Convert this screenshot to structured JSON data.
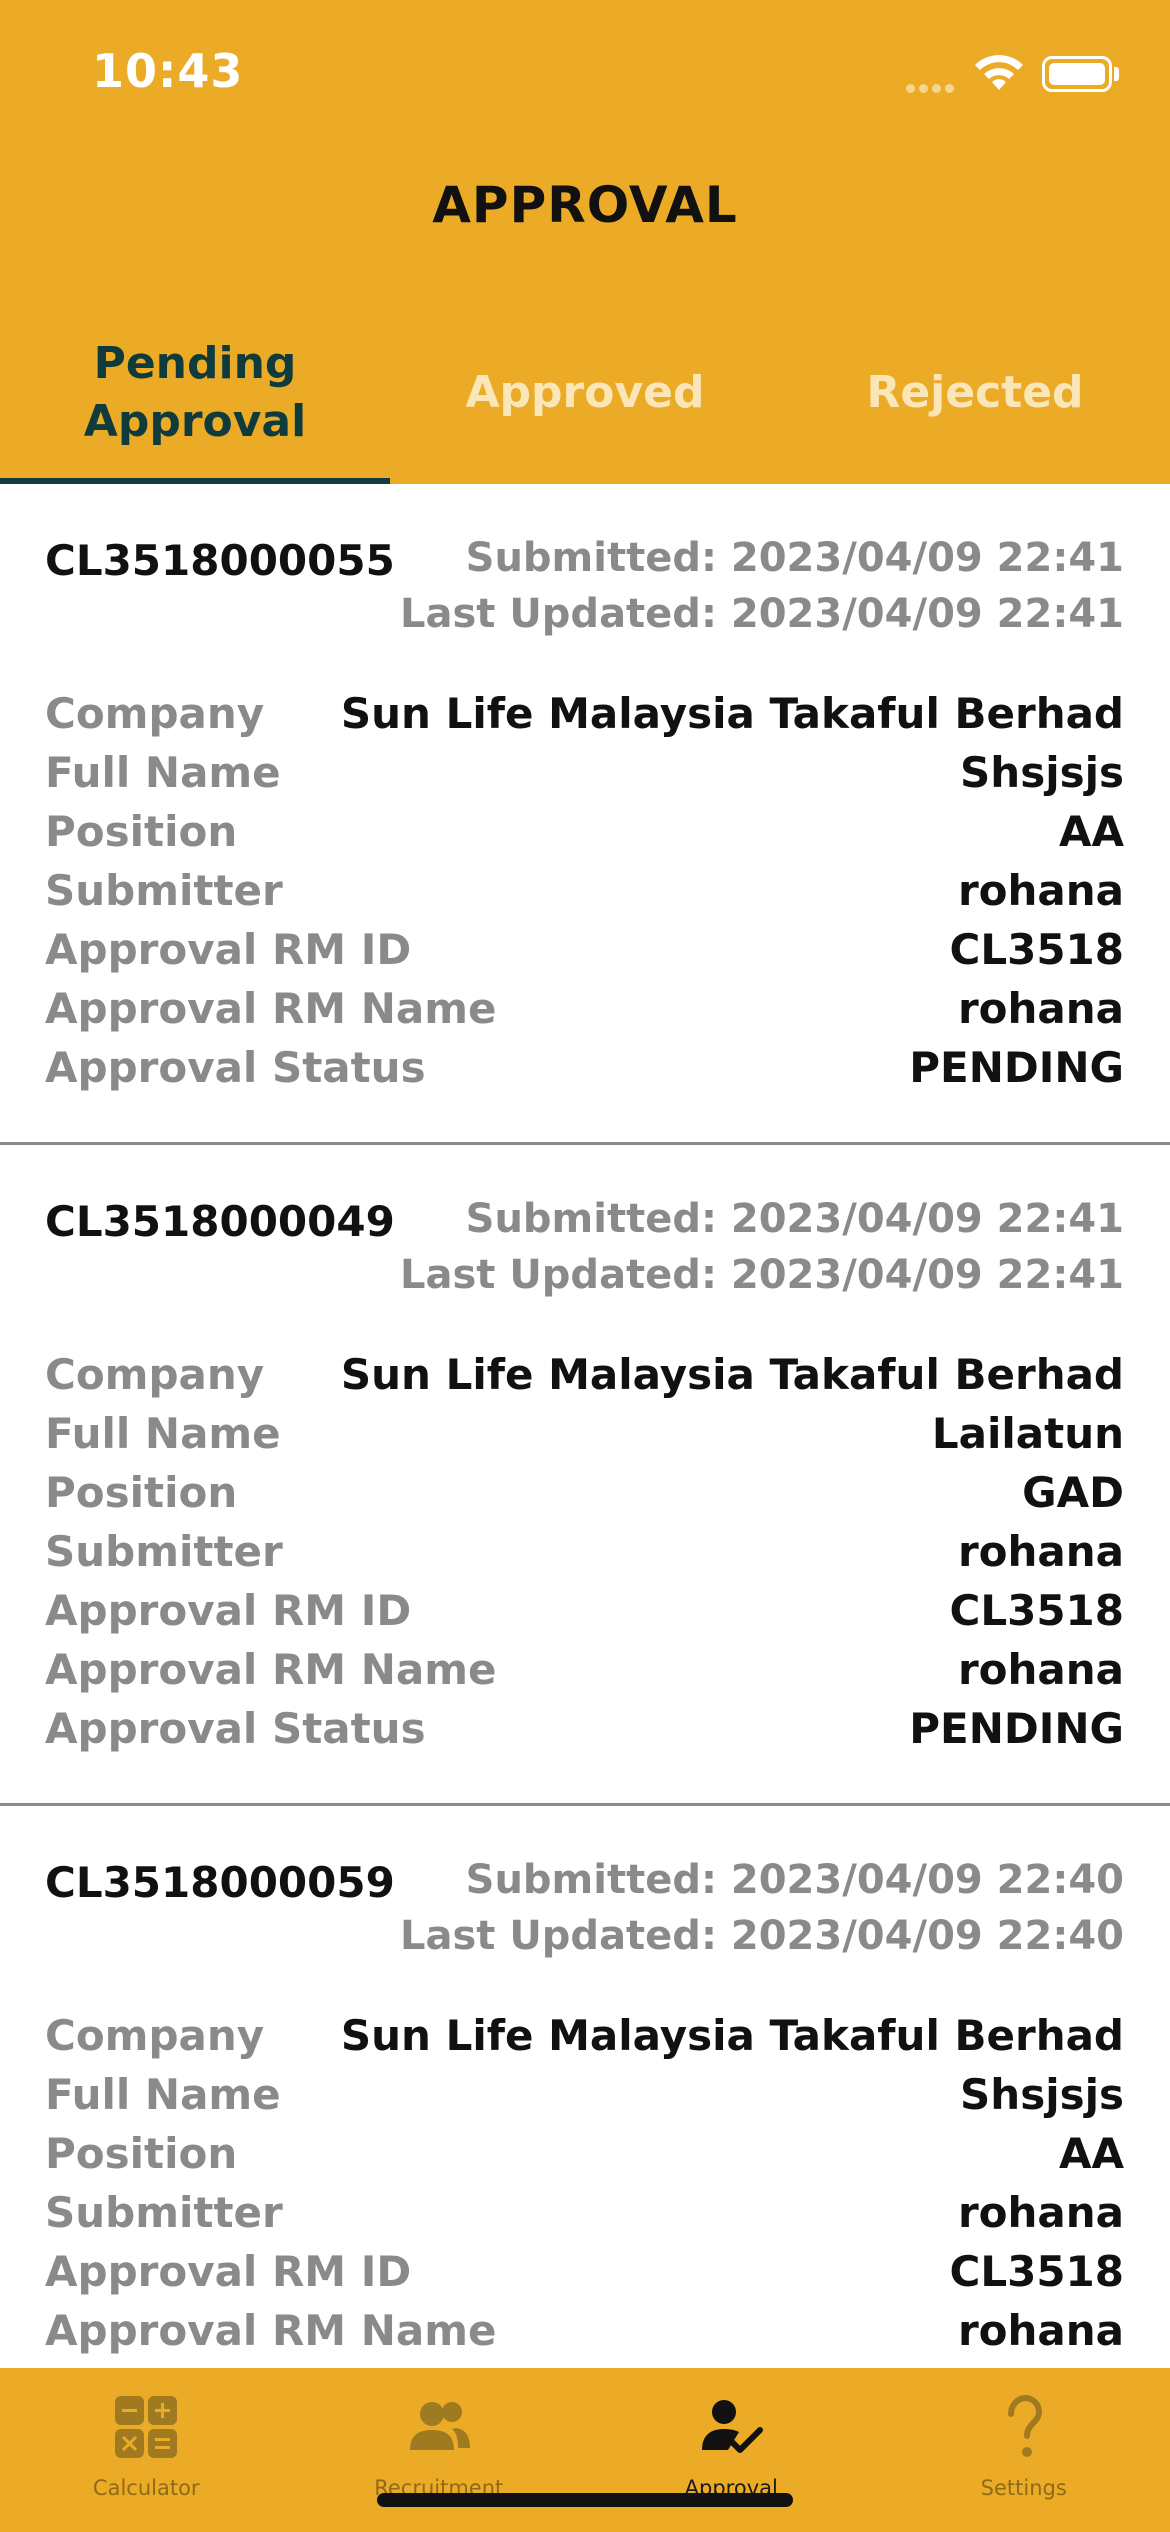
{
  "status_bar": {
    "time": "10:43"
  },
  "header": {
    "title": "APPROVAL"
  },
  "tabs": [
    {
      "label": "Pending\nApproval"
    },
    {
      "label": "Approved"
    },
    {
      "label": "Rejected"
    }
  ],
  "field_labels": {
    "company": "Company",
    "full_name": "Full Name",
    "position": "Position",
    "submitter": "Submitter",
    "rm_id": "Approval RM ID",
    "rm_name": "Approval RM Name",
    "status": "Approval Status"
  },
  "cards": [
    {
      "id": "CL3518000055",
      "submitted": "Submitted: 2023/04/09 22:41",
      "last_updated": "Last Updated: 2023/04/09 22:41",
      "company": "Sun Life Malaysia Takaful Berhad",
      "full_name": "Shsjsjs",
      "position": "AA",
      "submitter": "rohana",
      "rm_id": "CL3518",
      "rm_name": "rohana",
      "status": "PENDING"
    },
    {
      "id": "CL3518000049",
      "submitted": "Submitted: 2023/04/09 22:41",
      "last_updated": "Last Updated: 2023/04/09 22:41",
      "company": "Sun Life Malaysia Takaful Berhad",
      "full_name": "Lailatun",
      "position": "GAD",
      "submitter": "rohana",
      "rm_id": "CL3518",
      "rm_name": "rohana",
      "status": "PENDING"
    },
    {
      "id": "CL3518000059",
      "submitted": "Submitted: 2023/04/09 22:40",
      "last_updated": "Last Updated: 2023/04/09 22:40",
      "company": "Sun Life Malaysia Takaful Berhad",
      "full_name": "Shsjsjs",
      "position": "AA",
      "submitter": "rohana",
      "rm_id": "CL3518",
      "rm_name": "rohana"
    }
  ],
  "tabbar": [
    {
      "label": "Calculator",
      "icon": "calculator-icon"
    },
    {
      "label": "Recruitment",
      "icon": "people-icon"
    },
    {
      "label": "Approval",
      "icon": "user-check-icon"
    },
    {
      "label": "Settings",
      "icon": "question-icon"
    }
  ],
  "colors": {
    "accent": "#EBAB26",
    "active_tab": "#0F3B3D",
    "label_gray": "#8a8a8a"
  }
}
